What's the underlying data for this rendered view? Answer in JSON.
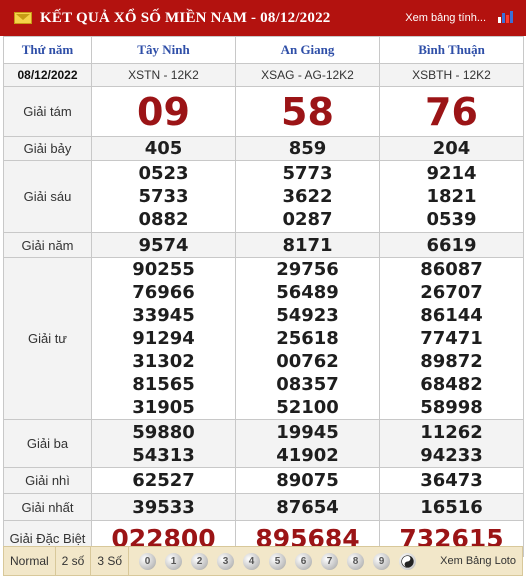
{
  "header": {
    "title": "KẾT QUẢ XỔ SỐ MIỀN NAM - 08/12/2022",
    "view_link": "Xem bảng tính...",
    "icons": {
      "left": "mail-icon",
      "right": "bar-chart-icon"
    }
  },
  "table": {
    "head": {
      "col0": "Thứ năm",
      "col1": "Tây Ninh",
      "col2": "An Giang",
      "col3": "Bình Thuận"
    },
    "codes": {
      "date": "08/12/2022",
      "c1": "XSTN - 12K2",
      "c2": "XSAG - AG-12K2",
      "c3": "XSBTH - 12K2"
    },
    "prizes": {
      "g8": {
        "label": "Giải tám",
        "values": [
          "09",
          "58",
          "76"
        ]
      },
      "g7": {
        "label": "Giải bảy",
        "values": [
          "405",
          "859",
          "204"
        ]
      },
      "g6": {
        "label": "Giải sáu",
        "values": [
          [
            "0523",
            "5733",
            "0882"
          ],
          [
            "5773",
            "3622",
            "0287"
          ],
          [
            "9214",
            "1821",
            "0539"
          ]
        ]
      },
      "g5": {
        "label": "Giải năm",
        "values": [
          "9574",
          "8171",
          "6619"
        ]
      },
      "g4": {
        "label": "Giải tư",
        "values": [
          [
            "90255",
            "76966",
            "33945",
            "91294",
            "31302",
            "81565",
            "31905"
          ],
          [
            "29756",
            "56489",
            "54923",
            "25618",
            "00762",
            "08357",
            "52100"
          ],
          [
            "86087",
            "26707",
            "86144",
            "77471",
            "89872",
            "68482",
            "58998"
          ]
        ]
      },
      "g3": {
        "label": "Giải ba",
        "values": [
          [
            "59880",
            "54313"
          ],
          [
            "19945",
            "41902"
          ],
          [
            "11262",
            "94233"
          ]
        ]
      },
      "g2": {
        "label": "Giải nhì",
        "values": [
          "62527",
          "89075",
          "36473"
        ]
      },
      "g1": {
        "label": "Giải nhất",
        "values": [
          "39533",
          "87654",
          "16516"
        ]
      },
      "db": {
        "label": "Giải Đặc Biệt",
        "values": [
          "022800",
          "895684",
          "732615"
        ]
      }
    }
  },
  "footer": {
    "tabs": [
      "Normal",
      "2 số",
      "3 Số"
    ],
    "digits": [
      "0",
      "1",
      "2",
      "3",
      "4",
      "5",
      "6",
      "7",
      "8",
      "9"
    ],
    "all_icon": "yin-yang-icon",
    "more_link": "Xem Bảng Loto"
  }
}
